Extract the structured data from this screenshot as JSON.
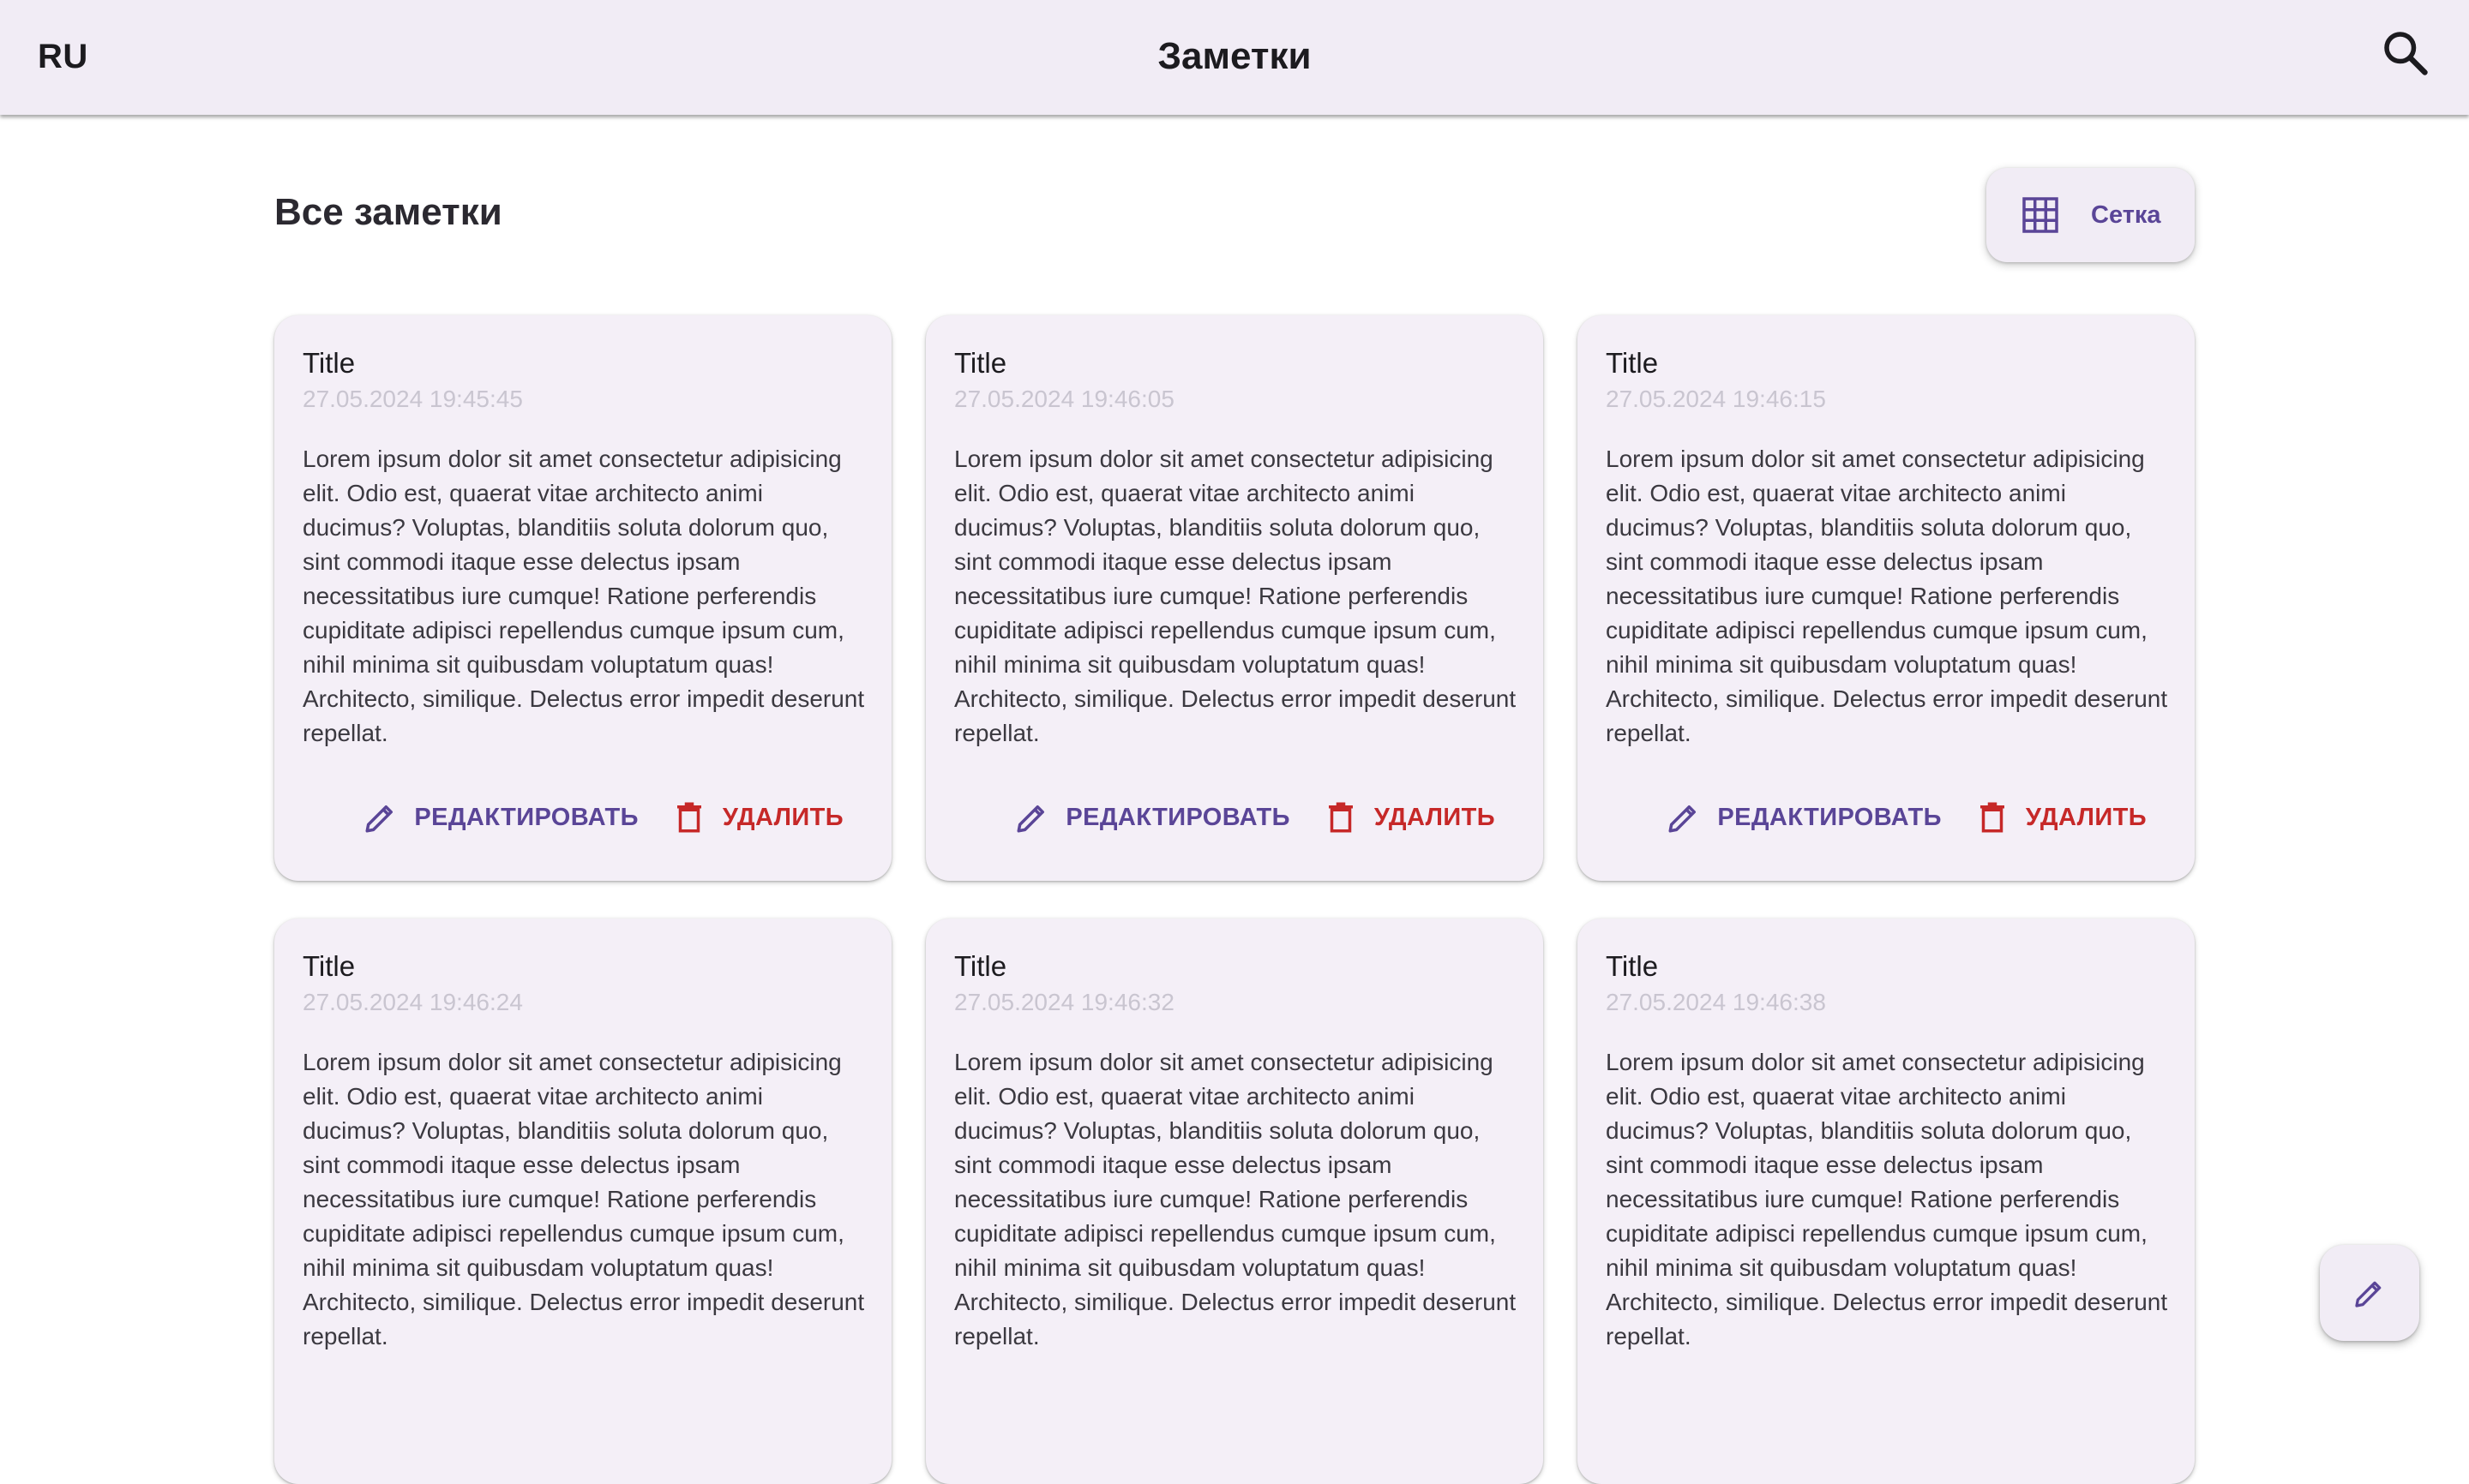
{
  "header": {
    "language_label": "RU",
    "title": "Заметки",
    "search_icon": "search-icon"
  },
  "main": {
    "section_title": "Все заметки",
    "view_toggle": {
      "label": "Сетка",
      "icon": "grid-icon"
    }
  },
  "notes": [
    {
      "title": "Title",
      "date": "27.05.2024 19:45:45",
      "text": "Lorem ipsum dolor sit amet consectetur adipisicing elit. Odio est, quaerat vitae architecto animi ducimus? Voluptas, blanditiis soluta dolorum quo, sint commodi itaque esse delectus ipsam necessitatibus iure cumque! Ratione perferendis cupiditate adipisci repellendus cumque ipsum cum, nihil minima sit quibusdam voluptatum quas! Architecto, similique. Delectus error impedit deserunt repellat.",
      "edit_label": "РЕДАКТИРОВАТЬ",
      "delete_label": "УДАЛИТЬ"
    },
    {
      "title": "Title",
      "date": "27.05.2024 19:46:05",
      "text": "Lorem ipsum dolor sit amet consectetur adipisicing elit. Odio est, quaerat vitae architecto animi ducimus? Voluptas, blanditiis soluta dolorum quo, sint commodi itaque esse delectus ipsam necessitatibus iure cumque! Ratione perferendis cupiditate adipisci repellendus cumque ipsum cum, nihil minima sit quibusdam voluptatum quas! Architecto, similique. Delectus error impedit deserunt repellat.",
      "edit_label": "РЕДАКТИРОВАТЬ",
      "delete_label": "УДАЛИТЬ"
    },
    {
      "title": "Title",
      "date": "27.05.2024 19:46:15",
      "text": "Lorem ipsum dolor sit amet consectetur adipisicing elit. Odio est, quaerat vitae architecto animi ducimus? Voluptas, blanditiis soluta dolorum quo, sint commodi itaque esse delectus ipsam necessitatibus iure cumque! Ratione perferendis cupiditate adipisci repellendus cumque ipsum cum, nihil minima sit quibusdam voluptatum quas! Architecto, similique. Delectus error impedit deserunt repellat.",
      "edit_label": "РЕДАКТИРОВАТЬ",
      "delete_label": "УДАЛИТЬ"
    },
    {
      "title": "Title",
      "date": "27.05.2024 19:46:24",
      "text": "Lorem ipsum dolor sit amet consectetur adipisicing elit. Odio est, quaerat vitae architecto animi ducimus? Voluptas, blanditiis soluta dolorum quo, sint commodi itaque esse delectus ipsam necessitatibus iure cumque! Ratione perferendis cupiditate adipisci repellendus cumque ipsum cum, nihil minima sit quibusdam voluptatum quas! Architecto, similique. Delectus error impedit deserunt repellat."
    },
    {
      "title": "Title",
      "date": "27.05.2024 19:46:32",
      "text": "Lorem ipsum dolor sit amet consectetur adipisicing elit. Odio est, quaerat vitae architecto animi ducimus? Voluptas, blanditiis soluta dolorum quo, sint commodi itaque esse delectus ipsam necessitatibus iure cumque! Ratione perferendis cupiditate adipisci repellendus cumque ipsum cum, nihil minima sit quibusdam voluptatum quas! Architecto, similique. Delectus error impedit deserunt repellat."
    },
    {
      "title": "Title",
      "date": "27.05.2024 19:46:38",
      "text": "Lorem ipsum dolor sit amet consectetur adipisicing elit. Odio est, quaerat vitae architecto animi ducimus? Voluptas, blanditiis soluta dolorum quo, sint commodi itaque esse delectus ipsam necessitatibus iure cumque! Ratione perferendis cupiditate adipisci repellendus cumque ipsum cum, nihil minima sit quibusdam voluptatum quas! Architecto, similique. Delectus error impedit deserunt repellat."
    }
  ],
  "fab": {
    "icon": "pencil-icon"
  },
  "colors": {
    "surface": "#f1ecf5",
    "card": "#f4eff7",
    "primary": "#5a4597",
    "danger": "#c62828",
    "muted_date": "#c9c5d0"
  }
}
